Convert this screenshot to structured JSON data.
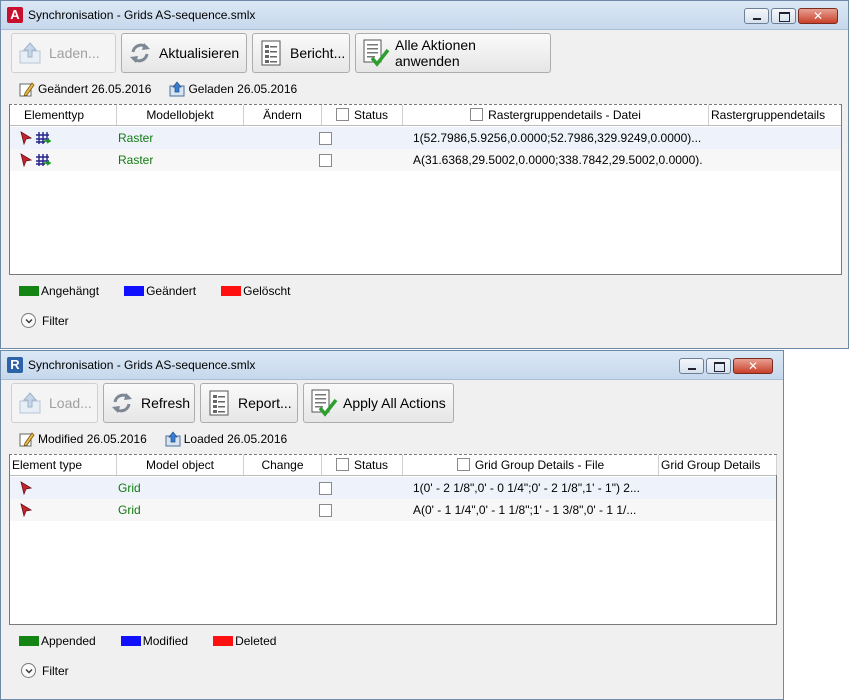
{
  "colors": {
    "appended": "#148414",
    "modified": "#1010ff",
    "deleted": "#ff1010",
    "object_text": "#127a12"
  },
  "top_window": {
    "title": "Synchronisation - Grids AS-sequence.smlx",
    "app_icon": "autocad-A-icon",
    "toolbar": {
      "load": "Laden...",
      "refresh": "Aktualisieren",
      "report": "Bericht...",
      "apply_all": "Alle Aktionen anwenden"
    },
    "info": {
      "modified": "Geändert 26.05.2016",
      "loaded": "Geladen 26.05.2016"
    },
    "columns": [
      "Elementtyp",
      "Modellobjekt",
      "Ändern",
      "Status",
      "Rastergruppendetails - Datei",
      "Rastergruppendetails"
    ],
    "rows": [
      {
        "object": "Raster",
        "details_file": "1(52.7986,5.9256,0.0000;52.7986,329.9249,0.0000)..."
      },
      {
        "object": "Raster",
        "details_file": "A(31.6368,29.5002,0.0000;338.7842,29.5002,0.0000)..."
      }
    ],
    "legend": {
      "appended": "Angehängt",
      "modified": "Geändert",
      "deleted": "Gelöscht"
    },
    "filter": "Filter"
  },
  "bottom_window": {
    "title": "Synchronisation - Grids AS-sequence.smlx",
    "app_icon": "revit-R-icon",
    "toolbar": {
      "load": "Load...",
      "refresh": "Refresh",
      "report": "Report...",
      "apply_all": "Apply All Actions"
    },
    "info": {
      "modified": "Modified 26.05.2016",
      "loaded": "Loaded 26.05.2016"
    },
    "columns": [
      "Element type",
      "Model object",
      "Change",
      "Status",
      "Grid Group Details - File",
      "Grid Group Details"
    ],
    "rows": [
      {
        "object": "Grid",
        "details_file": "1(0' - 2 1/8\",0' - 0 1/4\";0' - 2 1/8\",1' - 1\") 2..."
      },
      {
        "object": "Grid",
        "details_file": "A(0' - 1 1/4\",0' - 1 1/8\";1' - 1 3/8\",0' - 1 1/..."
      }
    ],
    "legend": {
      "appended": "Appended",
      "modified": "Modified",
      "deleted": "Deleted"
    },
    "filter": "Filter"
  }
}
